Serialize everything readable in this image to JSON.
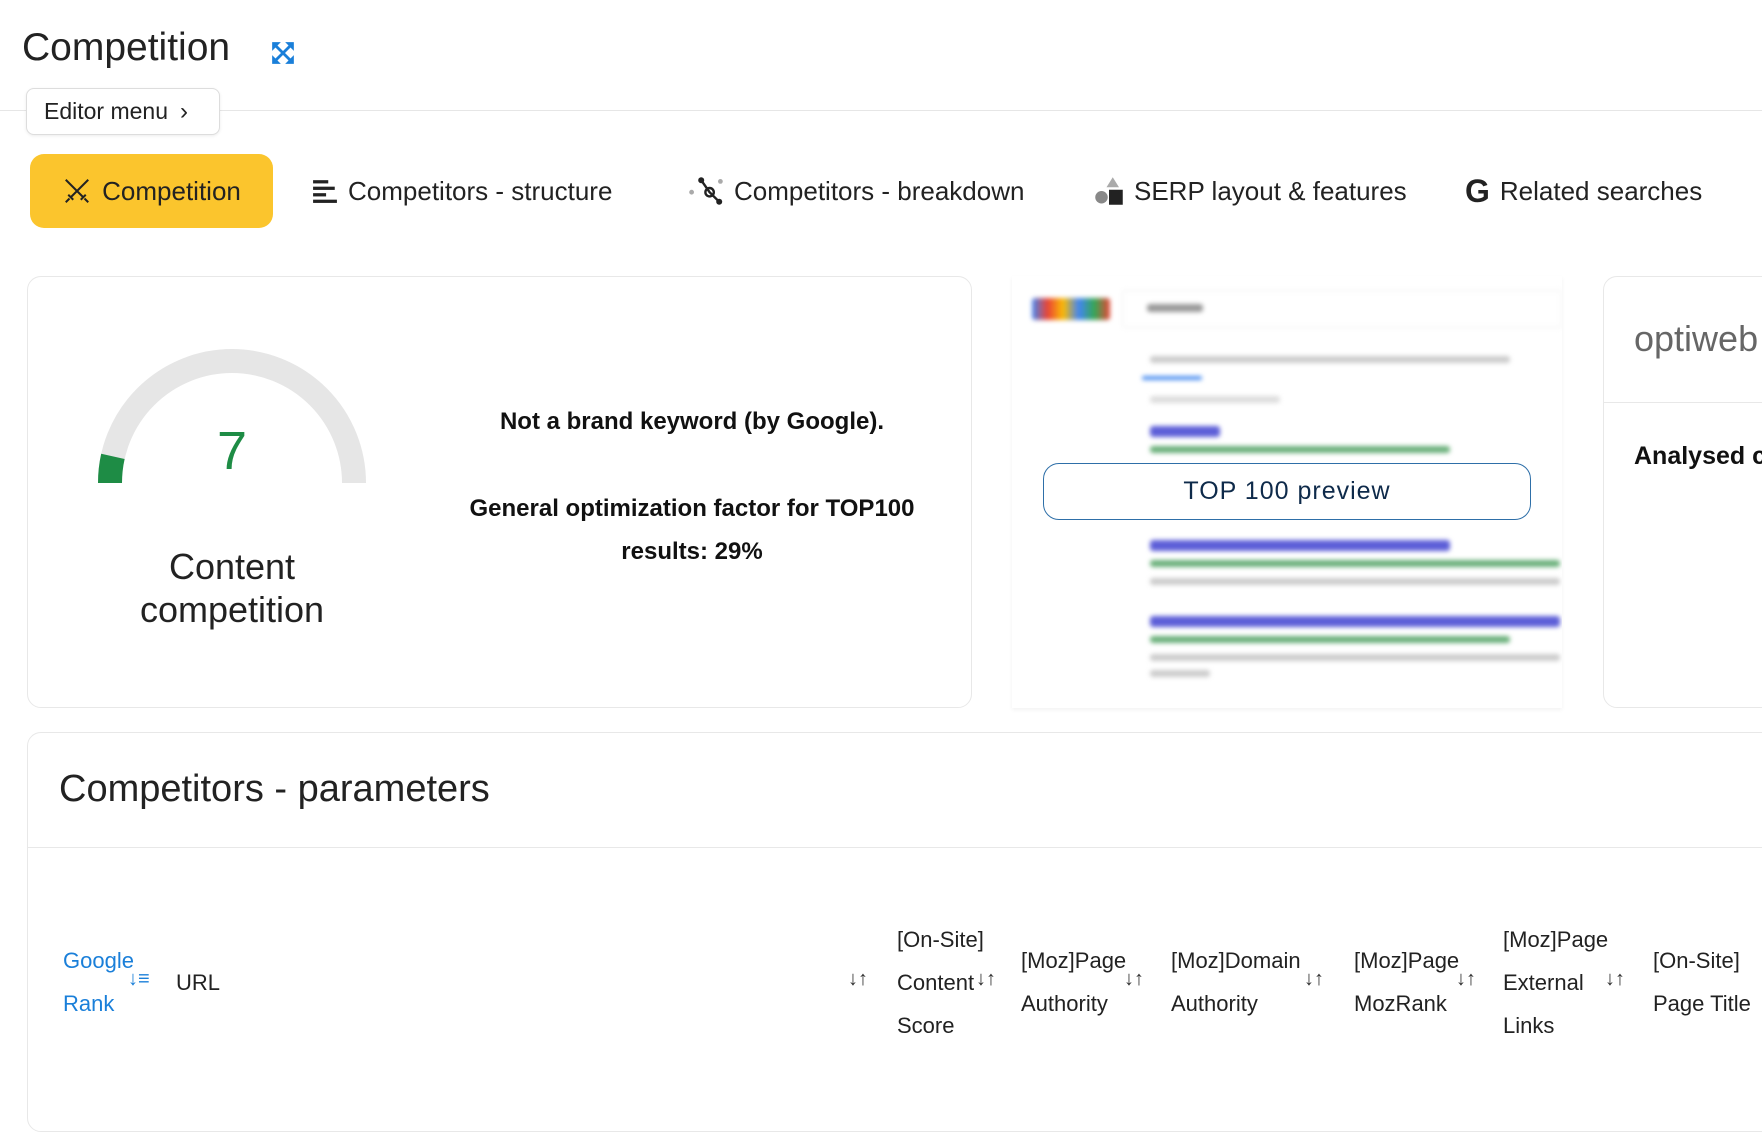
{
  "header": {
    "title": "Competition",
    "expand_icon": "expand-arrows-icon",
    "editor_menu": "Editor menu"
  },
  "tabs": [
    {
      "label": "Competition",
      "icon": "swords-icon",
      "active": true
    },
    {
      "label": "Competitors - structure",
      "icon": "structure-lines-icon"
    },
    {
      "label": "Competitors - breakdown",
      "icon": "nodes-icon"
    },
    {
      "label": "SERP layout & features",
      "icon": "shapes-icon"
    },
    {
      "label": "Related searches",
      "icon": "google-g-icon"
    }
  ],
  "competition": {
    "score": "7",
    "score_fraction": 0.07,
    "label": "Content competition",
    "brand_text": "Not a brand keyword (by Google).",
    "factor_text_1": "General optimization factor for TOP100",
    "factor_text_2": "results: 29%",
    "gauge_color": "#1e8c45"
  },
  "preview": {
    "button": "TOP 100 preview"
  },
  "side_card": {
    "title": "optiweb",
    "subtitle": "Analysed c"
  },
  "parameters": {
    "title": "Competitors - parameters",
    "columns": [
      {
        "lines": [
          "Google",
          "Rank"
        ],
        "sorted": true
      },
      {
        "lines": [
          "URL"
        ]
      },
      {
        "lines": [
          "[On-Site]",
          "Content",
          "Score"
        ]
      },
      {
        "lines": [
          "[Moz]Page",
          "Authority"
        ]
      },
      {
        "lines": [
          "[Moz]Domain",
          "Authority"
        ]
      },
      {
        "lines": [
          "[Moz]Page",
          "MozRank"
        ]
      },
      {
        "lines": [
          "[Moz]Page",
          "External",
          "Links"
        ]
      },
      {
        "lines": [
          "[On-Site]",
          "Page Title"
        ]
      }
    ]
  },
  "colors": {
    "accent": "#fbc52d",
    "link": "#1a7fd9"
  }
}
